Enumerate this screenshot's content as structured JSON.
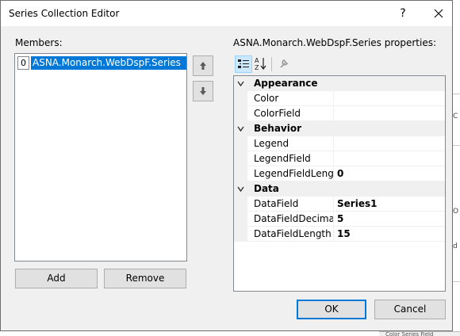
{
  "window": {
    "title": "Series Collection Editor"
  },
  "titlebar": {
    "help_glyph": "?"
  },
  "members": {
    "label": "Members:",
    "items": [
      {
        "index": "0",
        "name": "ASNA.Monarch.WebDspF.Series",
        "selected": true
      }
    ]
  },
  "buttons": {
    "add": "Add",
    "remove": "Remove",
    "ok": "OK",
    "cancel": "Cancel"
  },
  "properties": {
    "label": "ASNA.Monarch.WebDspF.Series properties:",
    "categories": [
      {
        "name": "Appearance",
        "props": [
          {
            "name": "Color",
            "value": ""
          },
          {
            "name": "ColorField",
            "value": ""
          }
        ]
      },
      {
        "name": "Behavior",
        "props": [
          {
            "name": "Legend",
            "value": ""
          },
          {
            "name": "LegendField",
            "value": ""
          },
          {
            "name": "LegendFieldLength",
            "value": "0"
          }
        ]
      },
      {
        "name": "Data",
        "props": [
          {
            "name": "DataField",
            "value": "Series1"
          },
          {
            "name": "DataFieldDecimals",
            "value": "5"
          },
          {
            "name": "DataFieldLength",
            "value": "15"
          }
        ]
      }
    ]
  },
  "background": {
    "right_edge_fragments": [
      "C",
      "O",
      "d",
      "D",
      "S",
      "D",
      "S"
    ],
    "bottom_fragment": "Color  Series  Field"
  },
  "colors": {
    "accent": "#0078d7",
    "dialog_bg": "#f0f0f0",
    "selection": "#0078d7"
  }
}
